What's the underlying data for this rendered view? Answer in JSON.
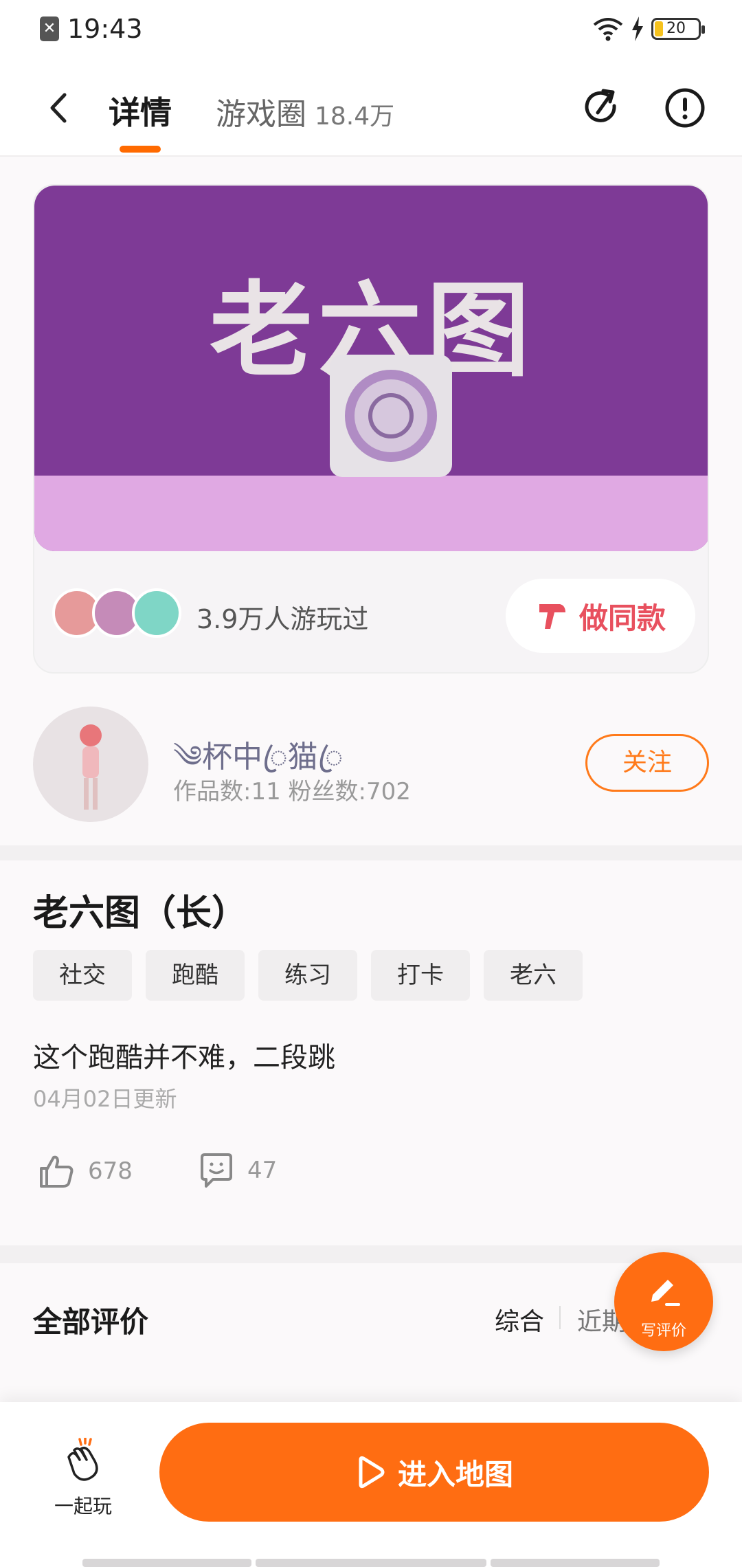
{
  "status_bar": {
    "time": "19:43",
    "battery": "20"
  },
  "header": {
    "tab_detail": "详情",
    "tab_circle": "游戏圈",
    "tab_circle_count": "18.4万",
    "icons": [
      "back-icon",
      "share-icon",
      "report-icon"
    ]
  },
  "game_card": {
    "banner_title": "老六图",
    "players_text": "3.9万人游玩过",
    "make_same_label": "做同款"
  },
  "author": {
    "name": "༄杯中ꦿ猫ꦿ",
    "stats": "作品数:11   粉丝数:702",
    "follow_label": "关注"
  },
  "work": {
    "title": "老六图（长）",
    "tags": [
      "社交",
      "跑酷",
      "练习",
      "打卡",
      "老六"
    ],
    "description": "这个跑酷并不难，二段跳",
    "updated": "04月02日更新",
    "likes": "678",
    "comments": "47"
  },
  "reviews": {
    "title": "全部评价",
    "sort_default": "综合",
    "sort_recent": "近期",
    "write_review_label": "写评价"
  },
  "bottom_bar": {
    "play_together_label": "一起玩",
    "enter_map_label": "进入地图"
  },
  "colors": {
    "accent": "#ff6d12",
    "banner": "#7e3a96",
    "banner_bottom": "#e0a9e3",
    "make_same": "#e8505e"
  }
}
